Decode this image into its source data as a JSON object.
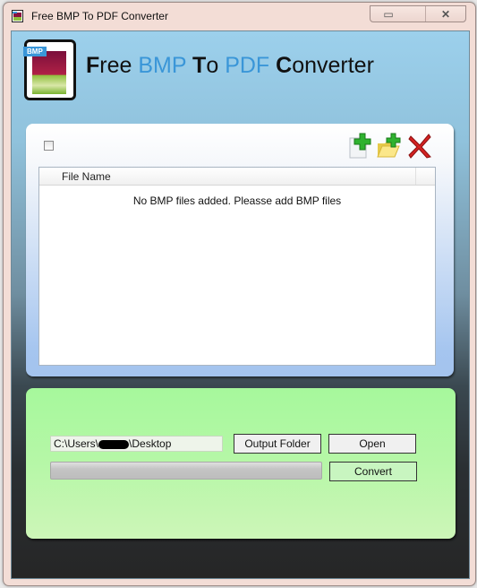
{
  "window": {
    "title": "Free BMP To PDF Converter",
    "minimize_symbol": "▭",
    "close_symbol": "✕"
  },
  "header": {
    "logo_tag": "BMP",
    "brand_parts": [
      {
        "cap": "F",
        "rest": "ree "
      },
      {
        "hl": "BMP "
      },
      {
        "cap": "T",
        "rest": "o "
      },
      {
        "hl": "PDF "
      },
      {
        "cap": "C",
        "rest": "onverter"
      }
    ]
  },
  "file_panel": {
    "select_all_checked": false,
    "tools": [
      {
        "name": "add-file",
        "icon": "add-file-icon"
      },
      {
        "name": "add-folder",
        "icon": "add-folder-icon"
      },
      {
        "name": "remove",
        "icon": "delete-icon"
      }
    ],
    "columns": [
      "File Name"
    ],
    "rows": [],
    "empty_message": "No BMP files added. Pleasse add BMP files"
  },
  "action_panel": {
    "output_path_prefix": "C:\\Users\\",
    "output_path_suffix": "\\Desktop",
    "output_folder_label": "Output Folder",
    "open_label": "Open",
    "convert_label": "Convert",
    "progress_percent": 0
  },
  "colors": {
    "accent_blue": "#3a96d8",
    "panel_green": "#a6f89c",
    "panel_blue": "#a5c5ef"
  }
}
